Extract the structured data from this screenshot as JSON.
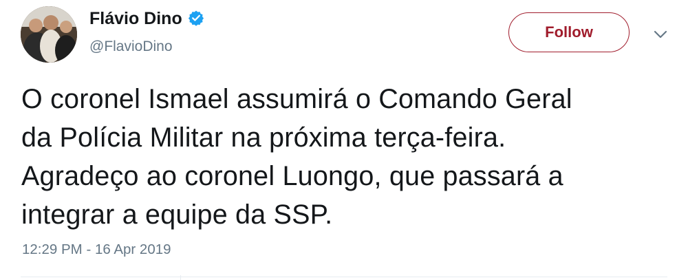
{
  "author": {
    "display_name": "Flávio Dino",
    "handle": "@FlavioDino",
    "verified": true,
    "avatar_icon": "profile-photo"
  },
  "actions": {
    "follow_label": "Follow",
    "menu_icon": "chevron-down-icon"
  },
  "tweet": {
    "lines": [
      "O coronel Ismael assumirá o Comando Geral",
      "da Polícia Militar na próxima terça-feira.",
      "Agradeço ao coronel Luongo, que passará a",
      "integrar a equipe da SSP."
    ],
    "timestamp": "12:29 PM - 16 Apr 2019"
  },
  "colors": {
    "accent": "#a01c2c",
    "verified_badge": "#1da1f2",
    "secondary_text": "#657786",
    "primary_text": "#14171a"
  }
}
